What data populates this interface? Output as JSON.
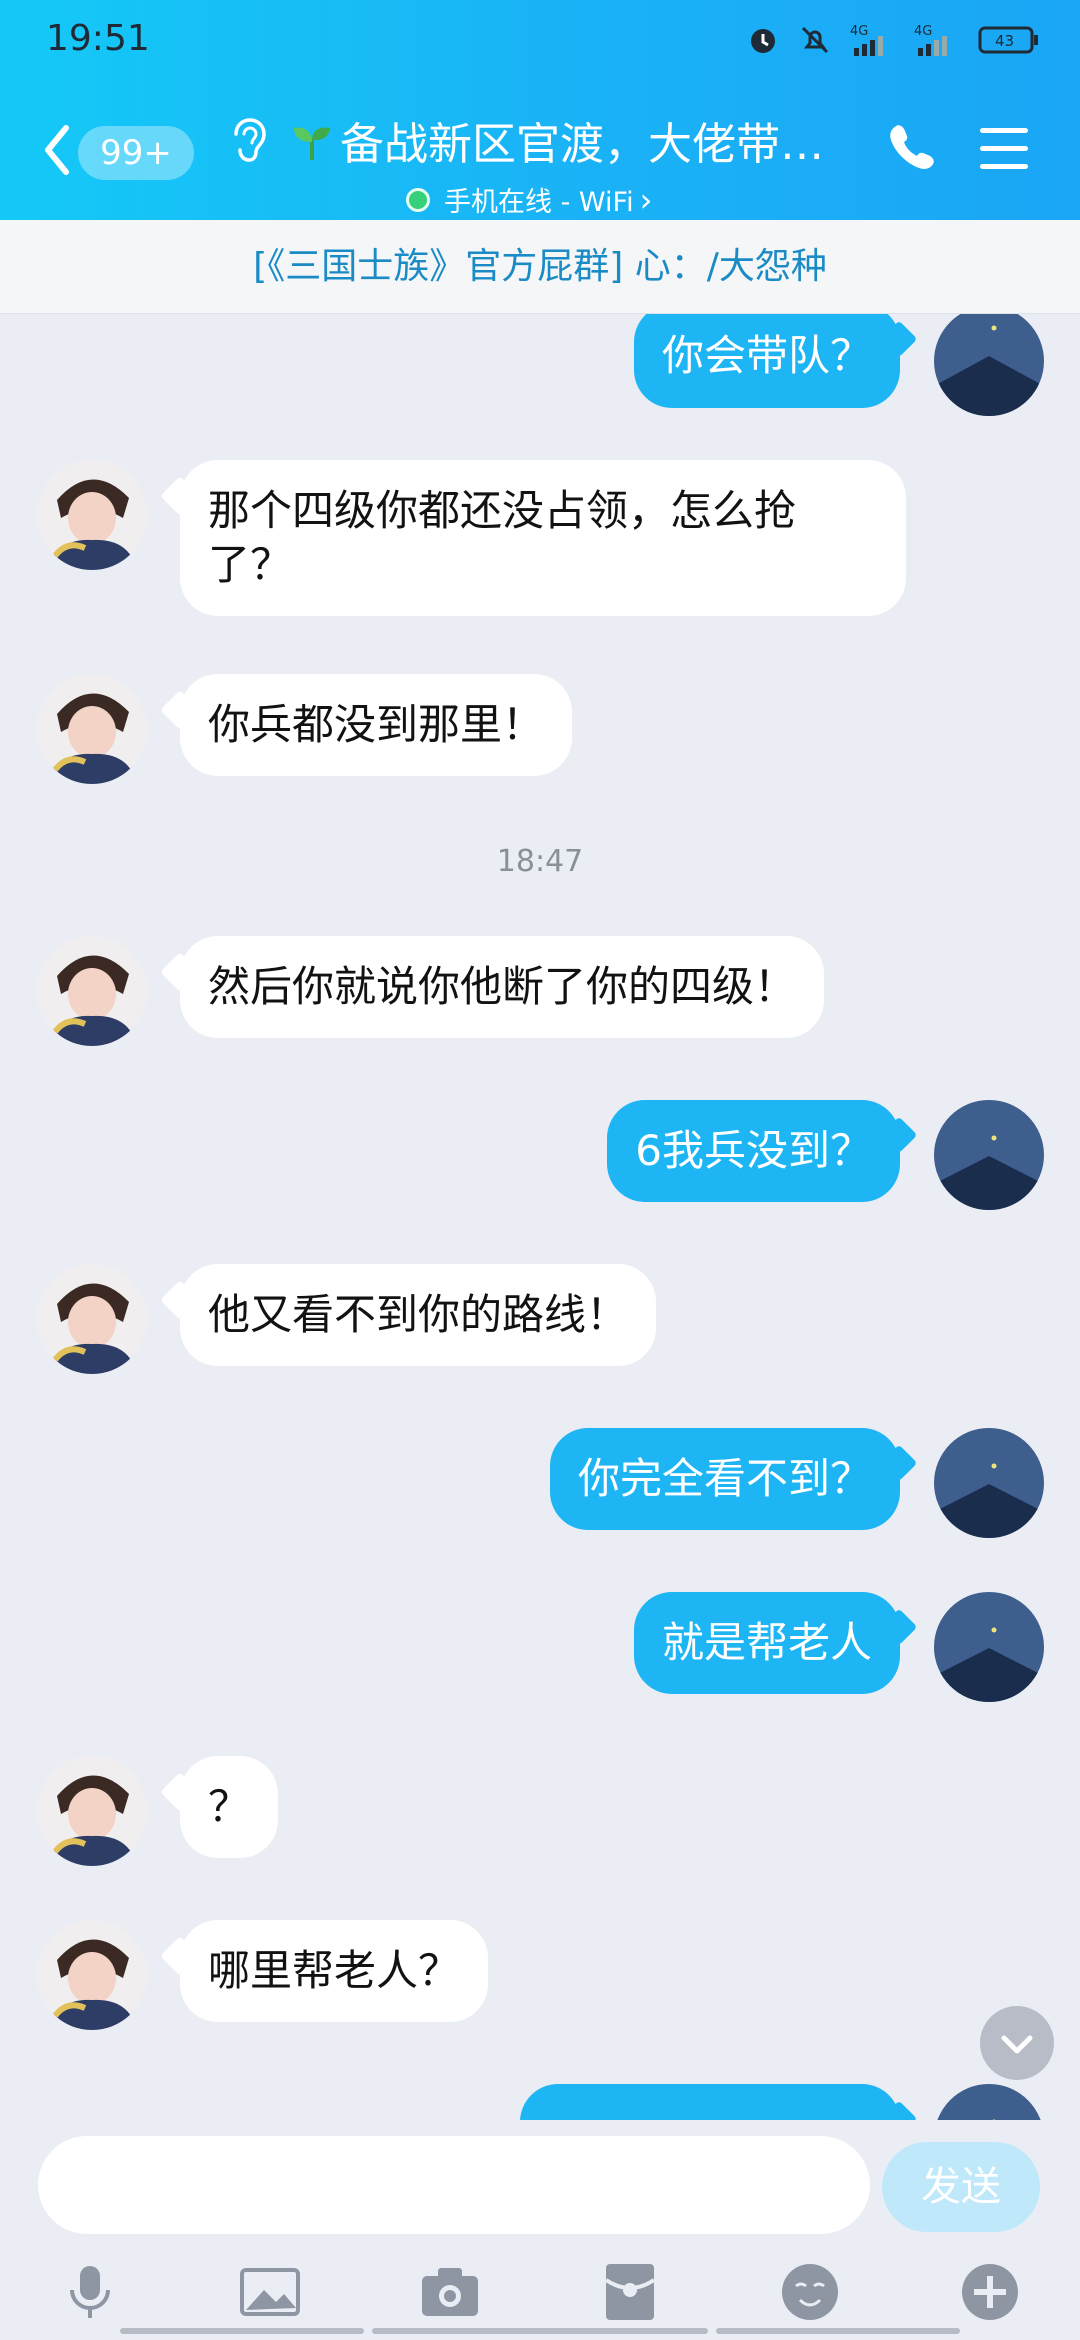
{
  "status_bar": {
    "time": "19:51",
    "battery": "43",
    "net1": "4G",
    "net2": "4G"
  },
  "header": {
    "unread_badge": "99+",
    "group_title": "备战新区官渡，大佬带…",
    "online_status": "手机在线 - WiFi",
    "status_chevron": "›"
  },
  "announcement": "[《三国士族》官方屁群] 心：/大怨种",
  "messages": [
    {
      "side": "out",
      "text": "你会带队？"
    },
    {
      "side": "in",
      "text": "那个四级你都还没占领，怎么抢了？"
    },
    {
      "side": "in",
      "text": "你兵都没到那里！"
    },
    {
      "side": "in",
      "text": "然后你就说你他断了你的四级！"
    },
    {
      "side": "out",
      "text": "6我兵没到？"
    },
    {
      "side": "in",
      "text": "他又看不到你的路线！"
    },
    {
      "side": "out",
      "text": "你完全看不到？"
    },
    {
      "side": "out",
      "text": "就是帮老人"
    },
    {
      "side": "in",
      "text": "？"
    },
    {
      "side": "in",
      "text": "哪里帮老人？"
    }
  ],
  "timestamp": "18:47",
  "input": {
    "placeholder": "",
    "send_label": "发送"
  },
  "toolbar_icons": [
    "microphone-icon",
    "image-icon",
    "camera-icon",
    "red-packet-icon",
    "emoji-icon",
    "plus-icon"
  ]
}
